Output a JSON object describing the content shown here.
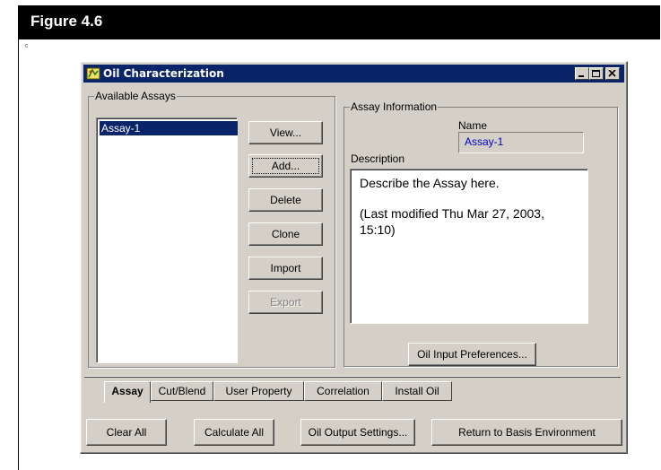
{
  "figure": {
    "title": "Figure 4.6",
    "mark": "c"
  },
  "window": {
    "title": "Oil Characterization"
  },
  "assays": {
    "group_label": "Available Assays",
    "items": [
      "Assay-1"
    ],
    "selected": "Assay-1"
  },
  "buttons": {
    "view": "View...",
    "add": "Add...",
    "delete": "Delete",
    "clone": "Clone",
    "import": "Import",
    "export": "Export",
    "oil_input_prefs": "Oil Input Preferences...",
    "clear_all": "Clear All",
    "calculate_all": "Calculate All",
    "oil_output_settings": "Oil Output Settings...",
    "return_basis": "Return to Basis Environment"
  },
  "assay_info": {
    "group_label": "Assay Information",
    "name_label": "Name",
    "name_value": "Assay-1",
    "description_label": "Description",
    "description_line1": "Describe the Assay here.",
    "description_line2": "(Last modified Thu Mar 27, 2003,",
    "description_line3": "15:10)"
  },
  "tabs": [
    "Assay",
    "Cut/Blend",
    "User Property",
    "Correlation",
    "Install Oil"
  ],
  "active_tab": "Assay",
  "colors": {
    "titlebar": "#0a246a",
    "selection": "#0a246a",
    "face": "#d4d0c8",
    "name_text": "#0000c0"
  }
}
